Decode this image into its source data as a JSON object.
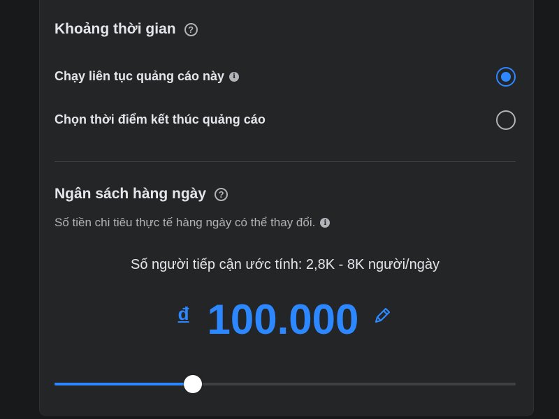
{
  "duration": {
    "title": "Khoảng thời gian",
    "help_icon": "question-circle-icon",
    "options": [
      {
        "label": "Chạy liên tục quảng cáo này",
        "has_info": true,
        "selected": true
      },
      {
        "label": "Chọn thời điểm kết thúc quảng cáo",
        "has_info": false,
        "selected": false
      }
    ]
  },
  "budget": {
    "title": "Ngân sách hàng ngày",
    "help_icon": "question-circle-icon",
    "subtitle": "Số tiền chi tiêu thực tế hàng ngày có thể thay đổi.",
    "info_icon": "info-circle-icon",
    "reach_text": "Số người tiếp cận ước tính: 2,8K - 8K người/ngày",
    "currency_symbol": "đ",
    "amount": "100.000",
    "edit_icon": "pencil-icon",
    "slider_value": 0.3
  },
  "colors": {
    "accent": "#2d88ff",
    "card_bg": "#242526",
    "page_bg": "#18191a",
    "text_primary": "#e4e6eb",
    "text_secondary": "#b0b3b8"
  }
}
